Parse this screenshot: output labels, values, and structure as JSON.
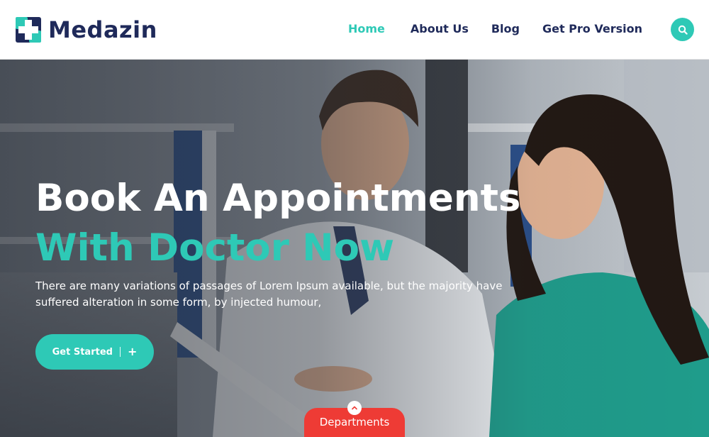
{
  "brand": {
    "name": "Medazin",
    "logo_icon": "medical-cross-logo"
  },
  "nav": {
    "home": "Home",
    "about": "About Us",
    "blog": "Blog",
    "pro": "Get Pro Version",
    "search_icon": "search-icon"
  },
  "hero": {
    "title_line1": "Book An Appointments",
    "title_line2": "With Doctor Now",
    "description": "There are many variations of passages of Lorem Ipsum available, but the majority have suffered alteration in some form, by injected humour,",
    "cta_label": "Get Started",
    "cta_icon": "+"
  },
  "departments": {
    "label": "Departments",
    "icon": "chevron-up-icon"
  },
  "colors": {
    "accent": "#2ec9b6",
    "navy": "#1f2a5a",
    "departments_red": "#ee3b35"
  }
}
